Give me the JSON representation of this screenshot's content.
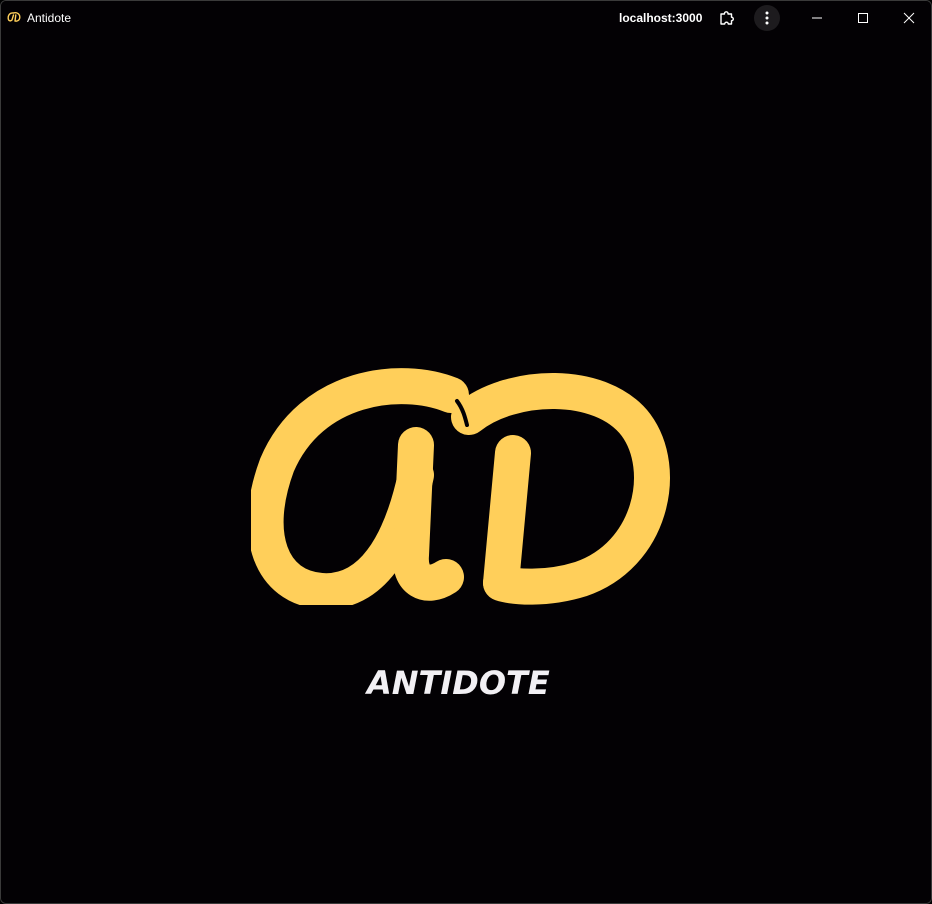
{
  "window": {
    "title": "Antidote",
    "url": "localhost:3000"
  },
  "icons": {
    "app": "antidote-logo-icon",
    "extensions": "puzzle-icon",
    "menu": "more-vertical-icon",
    "minimize": "minimize-icon",
    "maximize": "maximize-icon",
    "close": "close-icon"
  },
  "splash": {
    "brand_name": "ANTIDOTE",
    "logo": "antidote-ad-logo"
  },
  "colors": {
    "background": "#030104",
    "logo_yellow": "#FFCF5A",
    "brand_text": "#F2F0F4"
  }
}
